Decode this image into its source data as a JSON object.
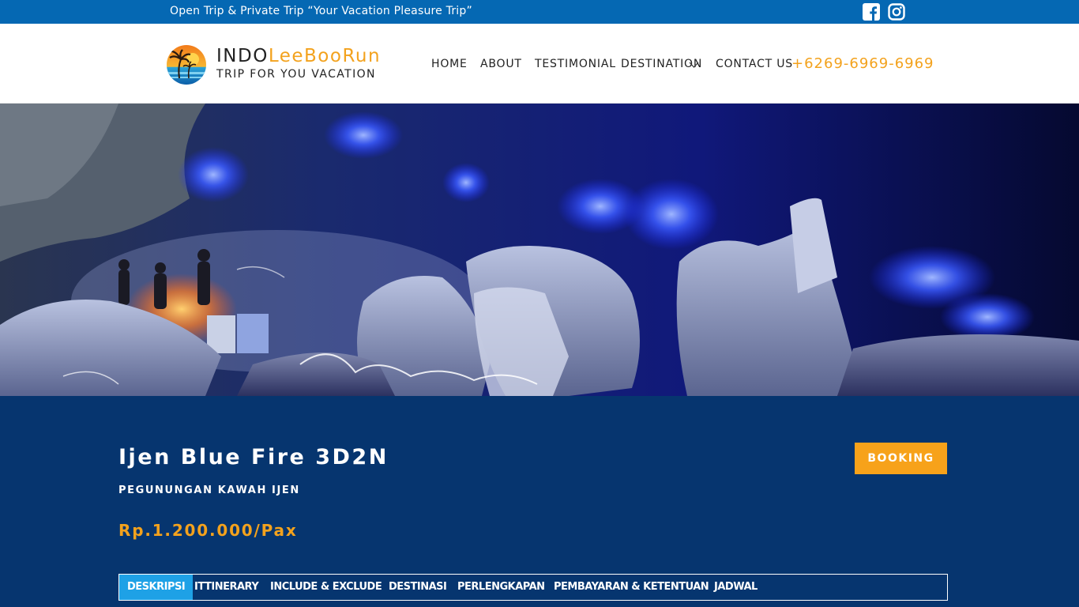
{
  "topbar": {
    "tagline": "Open Trip & Private Trip “Your Vacation Pleasure Trip”",
    "social": [
      "facebook-icon",
      "instagram-icon"
    ]
  },
  "header": {
    "brand_part1": "INDO",
    "brand_part2": "LeeBooRun",
    "subtitle": "TRIP FOR YOU VACATION",
    "nav": {
      "home": "HOME",
      "about": "ABOUT",
      "testimonial": "TESTIMONIAL",
      "destination": "DESTINATION",
      "contact": "CONTACT US"
    },
    "phone": "+6269-6969-6969"
  },
  "tour": {
    "title": "Ijen Blue Fire 3D2N",
    "region": "PEGUNUNGAN KAWAH IJEN",
    "price": "Rp.1.200.000/Pax",
    "booking_label": "BOOKING"
  },
  "tabs": [
    {
      "label": "DESKRIPSI",
      "active": true
    },
    {
      "label": "ITTINERARY",
      "active": false
    },
    {
      "label": "INCLUDE & EXCLUDE",
      "active": false
    },
    {
      "label": "DESTINASI",
      "active": false
    },
    {
      "label": "PERLENGKAPAN",
      "active": false
    },
    {
      "label": "PEMBAYARAN & KETENTUAN",
      "active": false
    },
    {
      "label": "JADWAL",
      "active": false
    }
  ],
  "colors": {
    "topbar": "#0568b3",
    "accent_orange": "#f3a21d",
    "detail_bg": "#06356f",
    "active_tab": "#1ea1e6"
  }
}
